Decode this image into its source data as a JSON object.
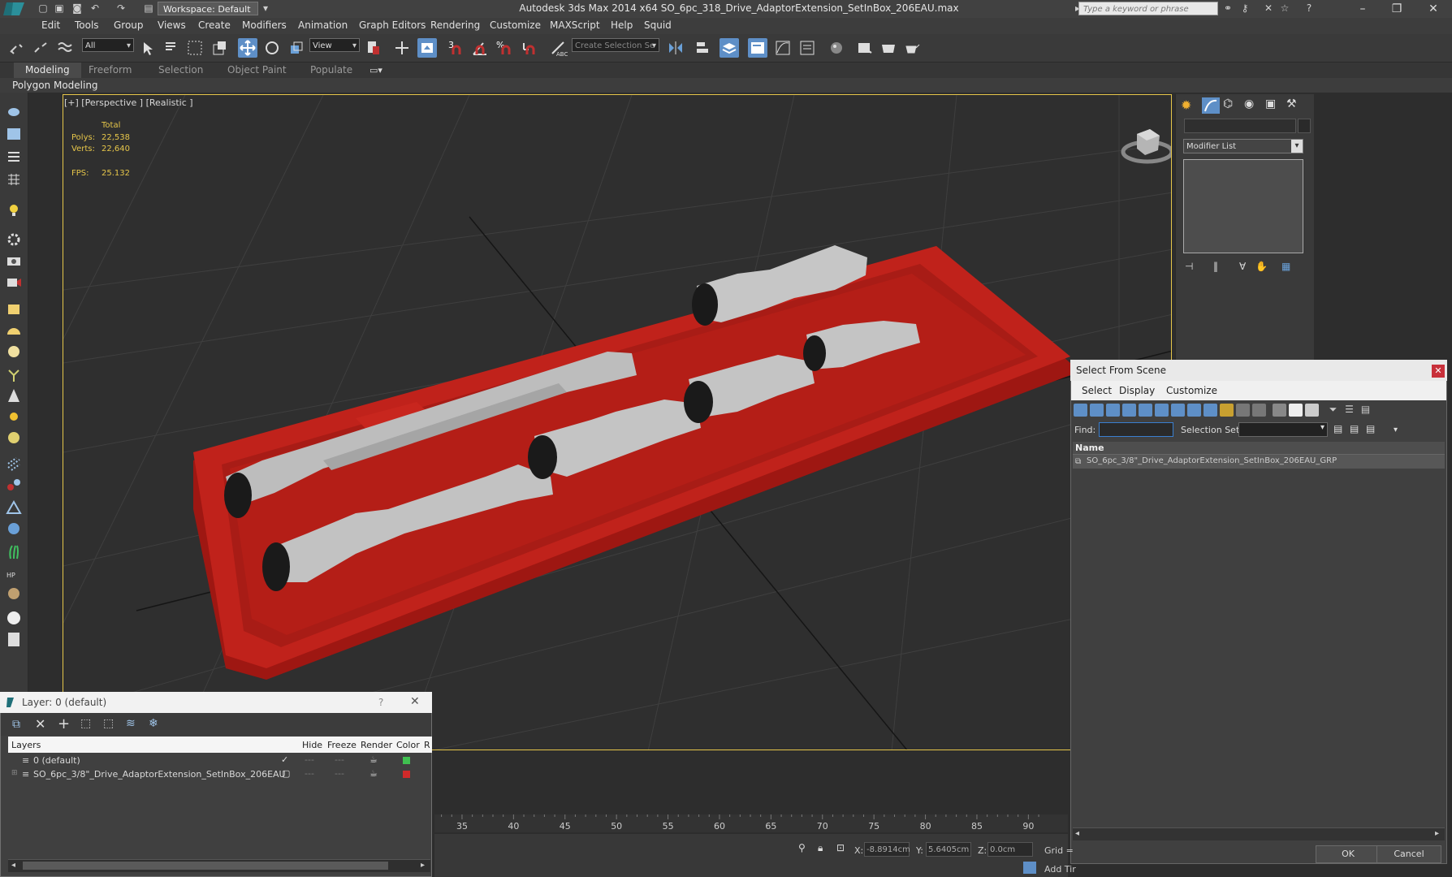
{
  "app": {
    "title": "Autodesk 3ds Max  2014 x64     SO_6pc_318_Drive_AdaptorExtension_SetInBox_206EAU.max",
    "workspace": "Workspace: Default",
    "search_placeholder": "Type a keyword or phrase"
  },
  "menu": [
    "Edit",
    "Tools",
    "Group",
    "Views",
    "Create",
    "Modifiers",
    "Animation",
    "Graph Editors",
    "Rendering",
    "Customize",
    "MAXScript",
    "Help",
    "Squid"
  ],
  "toolbar": {
    "filter": "All",
    "ref_coord": "View",
    "selection_set": "Create Selection Se",
    "snaps": [
      "3",
      "%"
    ]
  },
  "ribbon": {
    "tabs": [
      "Modeling",
      "Freeform",
      "Selection",
      "Object Paint",
      "Populate"
    ],
    "active_tab": "Modeling",
    "panel": "Polygon Modeling"
  },
  "viewport": {
    "label": "[+] [Perspective ] [Realistic ]",
    "stats": {
      "header": "Total",
      "polys_label": "Polys:",
      "polys": "22,538",
      "verts_label": "Verts:",
      "verts": "22,640",
      "fps_label": "FPS:",
      "fps": "25.132"
    }
  },
  "command_panel": {
    "modifier_list": "Modifier List"
  },
  "select_from_scene": {
    "title": "Select From Scene",
    "menu": [
      "Select",
      "Display",
      "Customize"
    ],
    "find_label": "Find:",
    "selection_set_label": "Selection Set:",
    "column": "Name",
    "rows": [
      "SO_6pc_3/8\"_Drive_AdaptorExtension_SetInBox_206EAU_GRP"
    ],
    "ok": "OK",
    "cancel": "Cancel"
  },
  "layer_dialog": {
    "title": "Layer: 0 (default)",
    "help": "?",
    "columns": [
      "Layers",
      "Hide",
      "Freeze",
      "Render",
      "Color",
      "R"
    ],
    "rows": [
      {
        "name": "0 (default)",
        "color": "#3fc050",
        "checked": true
      },
      {
        "name": "SO_6pc_3/8\"_Drive_AdaptorExtension_SetInBox_206EAU",
        "color": "#d02a2a",
        "checked": false
      }
    ]
  },
  "timeline": {
    "ticks": [
      "35",
      "40",
      "45",
      "50",
      "55",
      "60",
      "65",
      "70",
      "75",
      "80",
      "85",
      "90"
    ]
  },
  "status": {
    "x_label": "X:",
    "x": "-8.8914cm",
    "y_label": "Y:",
    "y": "5.6405cm",
    "z_label": "Z:",
    "z": "0.0cm",
    "grid": "Grid =",
    "add_time_tag": "Add Tir"
  },
  "colors": {
    "tray_red": "#c0221b",
    "chrome": "#bdbdbd",
    "accent_blue": "#5e8fc7",
    "viewport_border": "#e6c64a"
  }
}
